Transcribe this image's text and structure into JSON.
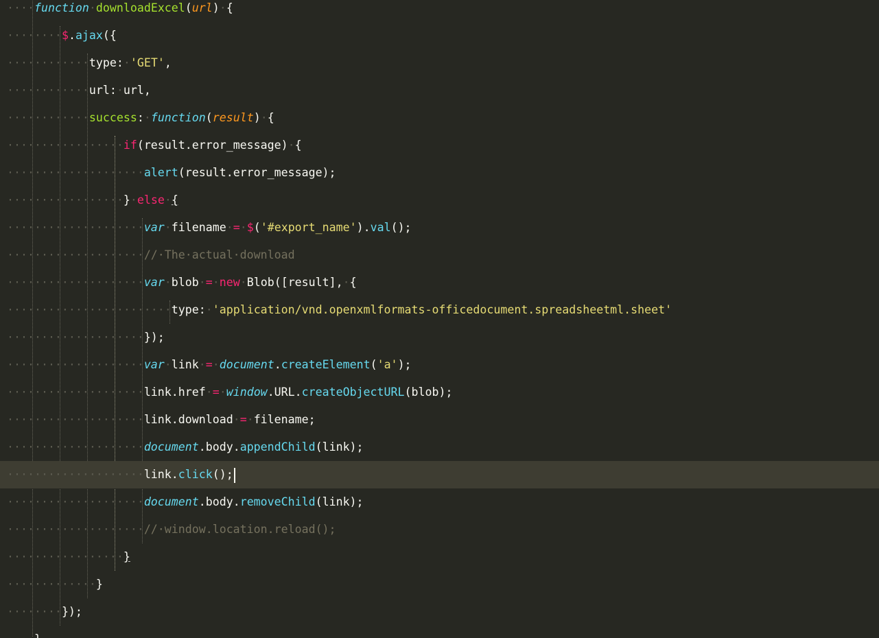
{
  "editor": {
    "theme": "Monokai",
    "colors": {
      "background": "#272822",
      "current_line": "#3e3d32",
      "default": "#f8f8f2",
      "storage": "#66d9ef",
      "function_name": "#a6e22e",
      "parameter": "#fd971f",
      "keyword": "#f92672",
      "string": "#e6db74",
      "comment": "#75715e",
      "whitespace_marker": "#5c5b50"
    },
    "current_line_index": 17
  },
  "lines": [
    {
      "indent": 4,
      "tokens": [
        {
          "t": "function",
          "c": "storage",
          "i": true
        },
        {
          "t": "·",
          "c": "ws"
        },
        {
          "t": "downloadExcel",
          "c": "fn"
        },
        {
          "t": "(",
          "c": "p"
        },
        {
          "t": "url",
          "c": "param",
          "i": true
        },
        {
          "t": ")",
          "c": "p"
        },
        {
          "t": "·",
          "c": "ws"
        },
        {
          "t": "{",
          "c": "p"
        }
      ]
    },
    {
      "indent": 8,
      "tokens": [
        {
          "t": "$",
          "c": "kw"
        },
        {
          "t": ".",
          "c": "p"
        },
        {
          "t": "ajax",
          "c": "call"
        },
        {
          "t": "({",
          "c": "p"
        }
      ]
    },
    {
      "indent": 12,
      "tokens": [
        {
          "t": "type",
          "c": "p"
        },
        {
          "t": ":",
          "c": "p"
        },
        {
          "t": "·",
          "c": "ws"
        },
        {
          "t": "'GET'",
          "c": "str"
        },
        {
          "t": ",",
          "c": "p"
        }
      ]
    },
    {
      "indent": 12,
      "tokens": [
        {
          "t": "url",
          "c": "p"
        },
        {
          "t": ":",
          "c": "p"
        },
        {
          "t": "·",
          "c": "ws"
        },
        {
          "t": "url",
          "c": "p"
        },
        {
          "t": ",",
          "c": "p"
        }
      ]
    },
    {
      "indent": 12,
      "tokens": [
        {
          "t": "success",
          "c": "fn"
        },
        {
          "t": ":",
          "c": "p"
        },
        {
          "t": "·",
          "c": "ws"
        },
        {
          "t": "function",
          "c": "storage",
          "i": true
        },
        {
          "t": "(",
          "c": "p"
        },
        {
          "t": "result",
          "c": "param",
          "i": true
        },
        {
          "t": ")",
          "c": "p"
        },
        {
          "t": "·",
          "c": "ws"
        },
        {
          "t": "{",
          "c": "p"
        }
      ]
    },
    {
      "indent": 17,
      "tokens": [
        {
          "t": "if",
          "c": "kw"
        },
        {
          "t": "(result.error_message)",
          "c": "p"
        },
        {
          "t": "·",
          "c": "ws"
        },
        {
          "t": "{",
          "c": "p"
        }
      ]
    },
    {
      "indent": 20,
      "tokens": [
        {
          "t": "alert",
          "c": "call"
        },
        {
          "t": "(result.error_message);",
          "c": "p"
        }
      ]
    },
    {
      "indent": 17,
      "tokens": [
        {
          "t": "}",
          "c": "p"
        },
        {
          "t": "·",
          "c": "ws"
        },
        {
          "t": "else",
          "c": "kw"
        },
        {
          "t": "·",
          "c": "ws"
        },
        {
          "t": "{",
          "c": "p",
          "u": true
        }
      ]
    },
    {
      "indent": 20,
      "tokens": [
        {
          "t": "var",
          "c": "storage",
          "i": true
        },
        {
          "t": "·",
          "c": "ws"
        },
        {
          "t": "filename",
          "c": "p"
        },
        {
          "t": "·",
          "c": "ws"
        },
        {
          "t": "=",
          "c": "kw"
        },
        {
          "t": "·",
          "c": "ws"
        },
        {
          "t": "$",
          "c": "kw"
        },
        {
          "t": "(",
          "c": "p"
        },
        {
          "t": "'#export_name'",
          "c": "str"
        },
        {
          "t": ").",
          "c": "p"
        },
        {
          "t": "val",
          "c": "call"
        },
        {
          "t": "();",
          "c": "p"
        }
      ]
    },
    {
      "indent": 20,
      "tokens": [
        {
          "t": "//·The·actual·download",
          "c": "cm"
        }
      ]
    },
    {
      "indent": 20,
      "tokens": [
        {
          "t": "var",
          "c": "storage",
          "i": true
        },
        {
          "t": "·",
          "c": "ws"
        },
        {
          "t": "blob",
          "c": "p"
        },
        {
          "t": "·",
          "c": "ws"
        },
        {
          "t": "=",
          "c": "kw"
        },
        {
          "t": "·",
          "c": "ws"
        },
        {
          "t": "new",
          "c": "kw"
        },
        {
          "t": "·",
          "c": "ws"
        },
        {
          "t": "Blob([result],",
          "c": "p"
        },
        {
          "t": "·",
          "c": "ws"
        },
        {
          "t": "{",
          "c": "p"
        }
      ]
    },
    {
      "indent": 24,
      "tokens": [
        {
          "t": "type",
          "c": "p"
        },
        {
          "t": ":",
          "c": "p"
        },
        {
          "t": "·",
          "c": "ws"
        },
        {
          "t": "'application/vnd.openxmlformats-officedocument.spreadsheetml.sheet'",
          "c": "str"
        }
      ]
    },
    {
      "indent": 20,
      "tokens": [
        {
          "t": "});",
          "c": "p"
        }
      ]
    },
    {
      "indent": 20,
      "tokens": [
        {
          "t": "var",
          "c": "storage",
          "i": true
        },
        {
          "t": "·",
          "c": "ws"
        },
        {
          "t": "link",
          "c": "p"
        },
        {
          "t": "·",
          "c": "ws"
        },
        {
          "t": "=",
          "c": "kw"
        },
        {
          "t": "·",
          "c": "ws"
        },
        {
          "t": "document",
          "c": "storage",
          "i": true
        },
        {
          "t": ".",
          "c": "p"
        },
        {
          "t": "createElement",
          "c": "call"
        },
        {
          "t": "(",
          "c": "p"
        },
        {
          "t": "'a'",
          "c": "str"
        },
        {
          "t": ");",
          "c": "p"
        }
      ]
    },
    {
      "indent": 20,
      "tokens": [
        {
          "t": "link.href",
          "c": "p"
        },
        {
          "t": "·",
          "c": "ws"
        },
        {
          "t": "=",
          "c": "kw"
        },
        {
          "t": "·",
          "c": "ws"
        },
        {
          "t": "window",
          "c": "storage",
          "i": true
        },
        {
          "t": ".URL.",
          "c": "p"
        },
        {
          "t": "createObjectURL",
          "c": "call"
        },
        {
          "t": "(blob);",
          "c": "p"
        }
      ]
    },
    {
      "indent": 20,
      "tokens": [
        {
          "t": "link.download",
          "c": "p"
        },
        {
          "t": "·",
          "c": "ws"
        },
        {
          "t": "=",
          "c": "kw"
        },
        {
          "t": "·",
          "c": "ws"
        },
        {
          "t": "filename;",
          "c": "p"
        }
      ]
    },
    {
      "indent": 20,
      "tokens": [
        {
          "t": "document",
          "c": "storage",
          "i": true
        },
        {
          "t": ".body.",
          "c": "p"
        },
        {
          "t": "appendChild",
          "c": "call"
        },
        {
          "t": "(link);",
          "c": "p"
        }
      ]
    },
    {
      "indent": 20,
      "tokens": [
        {
          "t": "link.",
          "c": "p"
        },
        {
          "t": "click",
          "c": "call"
        },
        {
          "t": "();",
          "c": "p"
        }
      ],
      "caret": true
    },
    {
      "indent": 20,
      "tokens": [
        {
          "t": "document",
          "c": "storage",
          "i": true
        },
        {
          "t": ".body.",
          "c": "p"
        },
        {
          "t": "removeChild",
          "c": "call"
        },
        {
          "t": "(link);",
          "c": "p"
        }
      ]
    },
    {
      "indent": 20,
      "tokens": [
        {
          "t": "//·window.location.reload();",
          "c": "cm"
        }
      ]
    },
    {
      "indent": 17,
      "tokens": [
        {
          "t": "}",
          "c": "p",
          "u": true
        }
      ]
    },
    {
      "indent": 13,
      "tokens": [
        {
          "t": "}",
          "c": "p"
        }
      ]
    },
    {
      "indent": 8,
      "tokens": [
        {
          "t": "});",
          "c": "p"
        }
      ]
    },
    {
      "indent": 4,
      "tokens": [
        {
          "t": "}",
          "c": "p"
        }
      ]
    }
  ]
}
